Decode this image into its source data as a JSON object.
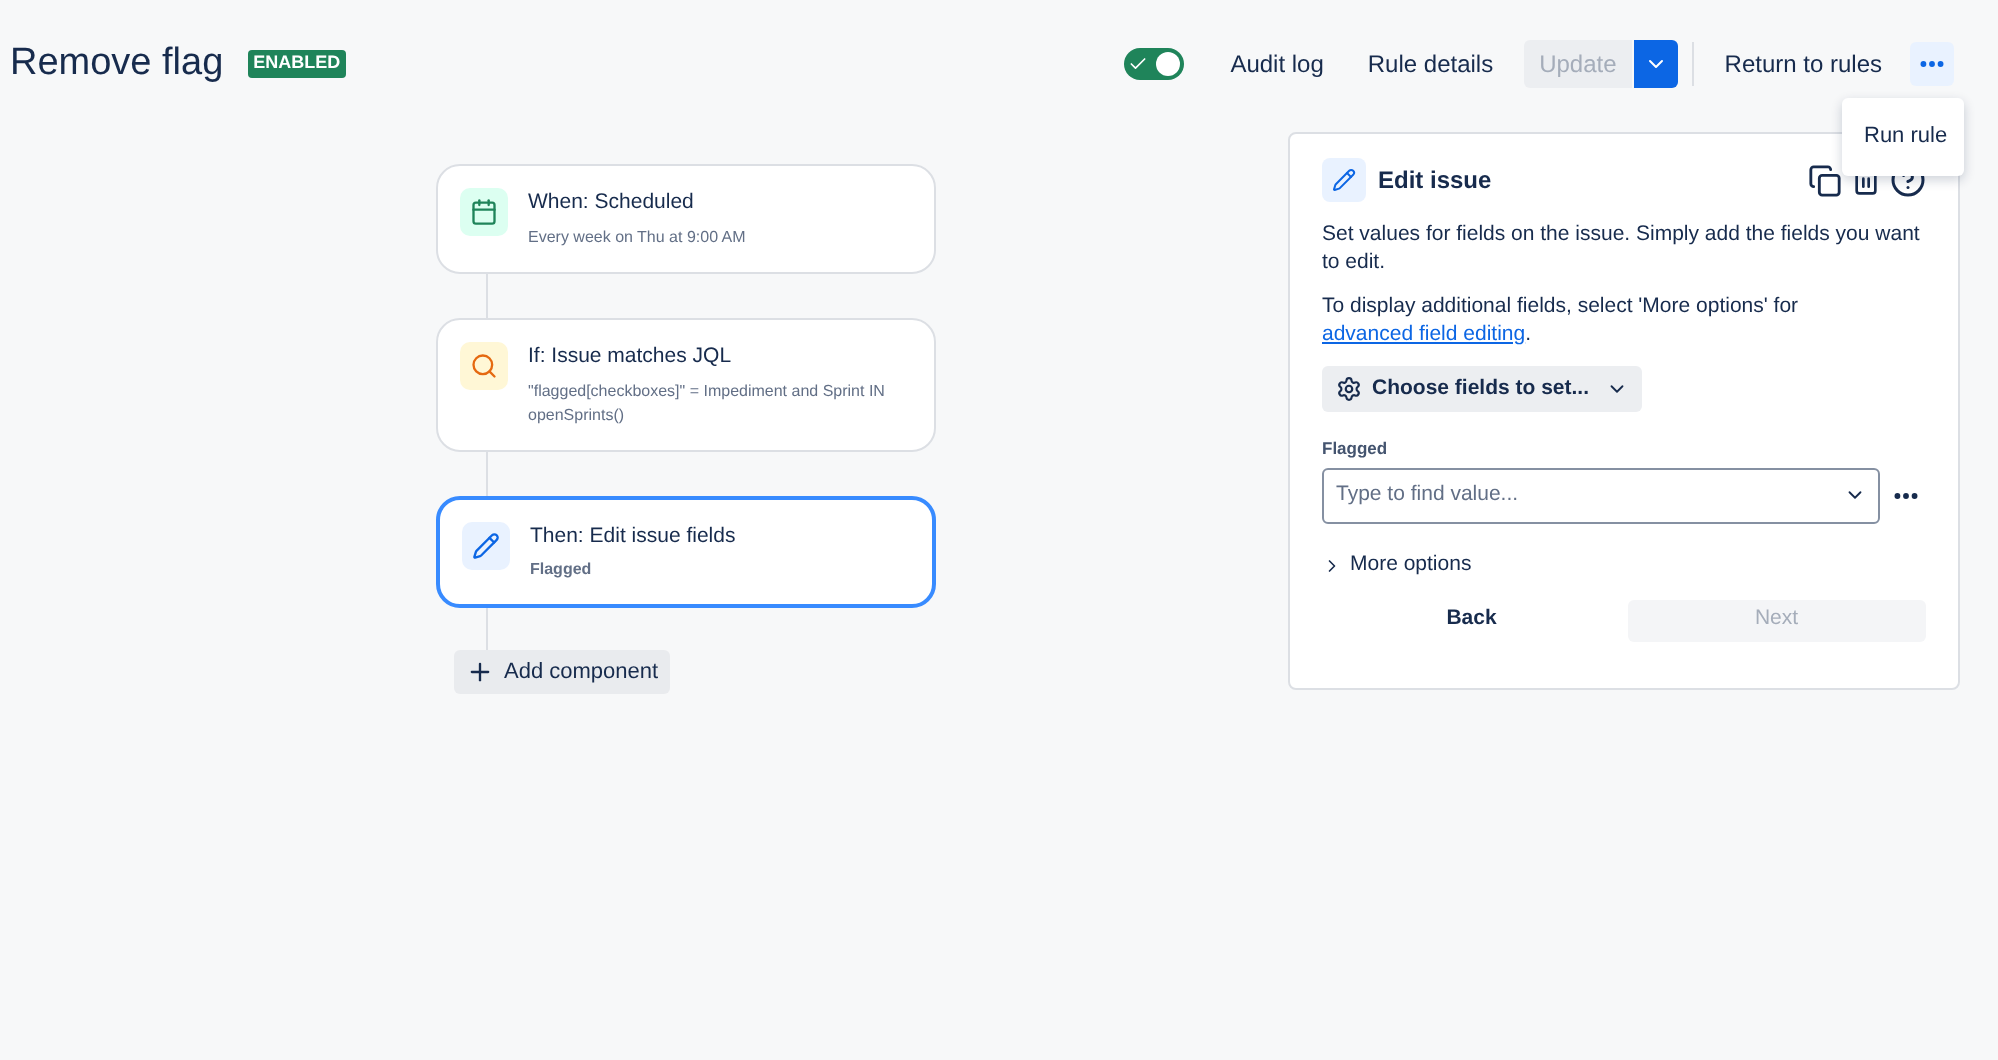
{
  "header": {
    "title": "Remove flag",
    "status": "ENABLED",
    "enabled": true,
    "actions": [
      "Audit log",
      "Rule details"
    ],
    "update": {
      "label": "Update",
      "disabled": true
    },
    "return": "Return to rules",
    "more_menu": {
      "expanded": true,
      "items": [
        "Run rule"
      ]
    }
  },
  "flow": {
    "steps": [
      {
        "kind": "trigger",
        "title": "When: Scheduled",
        "detail": "Every week on Thu at 9:00 AM",
        "selected": false
      },
      {
        "kind": "condition",
        "title": "If: Issue matches JQL",
        "detail": "\"flagged[checkboxes]\" = Impediment and Sprint IN openSprints()",
        "selected": false
      },
      {
        "kind": "action",
        "title": "Then: Edit issue fields",
        "detail": "Flagged",
        "selected": true
      }
    ],
    "add_label": "Add component"
  },
  "panel": {
    "title": "Edit issue",
    "description": "Set values for fields on the issue. Simply add the fields you want to edit.",
    "note": "To display additional fields, select 'More options' for",
    "link": "advanced field editing",
    "note_end": ".",
    "choose_label": "Choose fields to set...",
    "field_label": "Flagged",
    "field_placeholder": "Type to find value...",
    "more_options": "More options",
    "back": "Back",
    "next": {
      "label": "Next",
      "disabled": true
    }
  }
}
